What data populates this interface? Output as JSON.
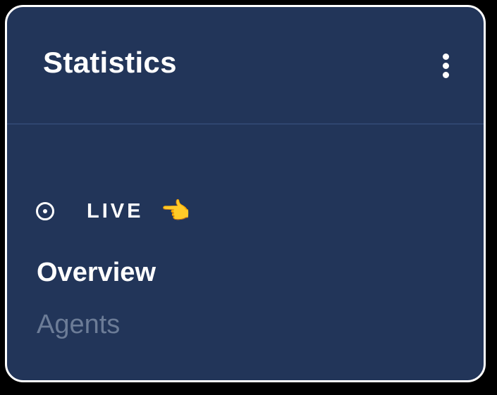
{
  "card": {
    "title": "Statistics"
  },
  "menu": {
    "icon": "more-vertical-icon"
  },
  "live": {
    "label": "LIVE",
    "status_icon": "radio-dot-icon",
    "pointer_emoji": "👈"
  },
  "nav": {
    "items": [
      {
        "label": "Overview",
        "active": true
      },
      {
        "label": "Agents",
        "active": false
      }
    ]
  },
  "colors": {
    "background": "#223559",
    "text_primary": "#ffffff",
    "text_muted": "#6c7c97",
    "border": "#ffffff"
  }
}
